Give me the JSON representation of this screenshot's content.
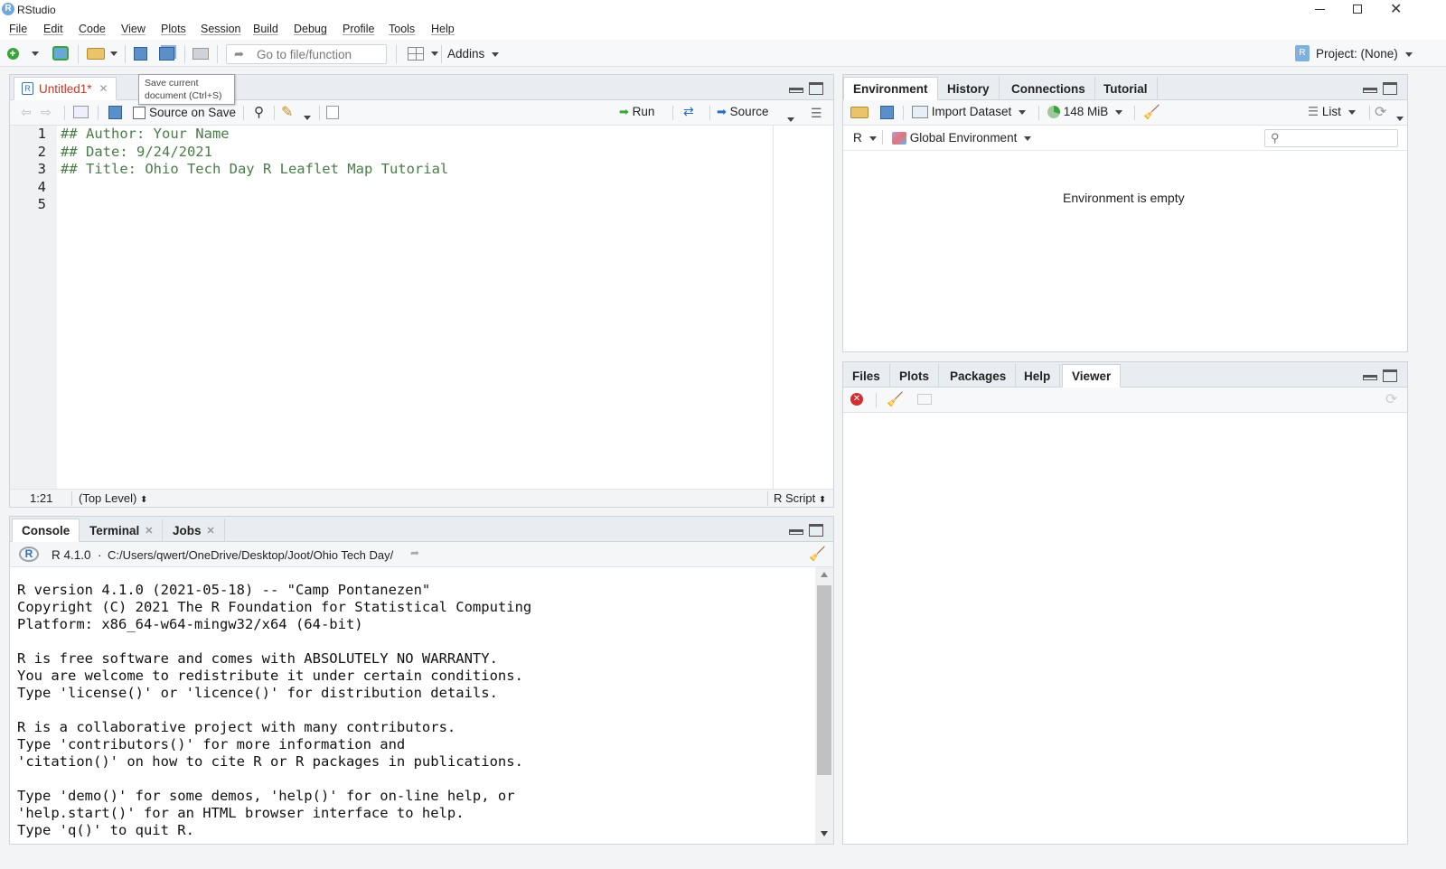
{
  "window": {
    "title": "RStudio"
  },
  "menu": [
    "File",
    "Edit",
    "Code",
    "View",
    "Plots",
    "Session",
    "Build",
    "Debug",
    "Profile",
    "Tools",
    "Help"
  ],
  "toolbar": {
    "goto_placeholder": "Go to file/function",
    "addins_label": "Addins",
    "project_label": "Project: (None)"
  },
  "tooltip": {
    "line1": "Save current",
    "line2": "document (Ctrl+S)"
  },
  "editor": {
    "tab_label": "Untitled1*",
    "source_on_save": "Source on Save",
    "run_label": "Run",
    "source_label": "Source",
    "line_numbers": [
      "1",
      "2",
      "3",
      "4",
      "5"
    ],
    "lines": [
      "## Author: Your Name",
      "## Date: 9/24/2021",
      "## Title: Ohio Tech Day R Leaflet Map Tutorial",
      "",
      ""
    ],
    "status_position": "1:21",
    "status_scope": "(Top Level)",
    "status_filetype": "R Script"
  },
  "console": {
    "tabs": [
      "Console",
      "Terminal",
      "Jobs"
    ],
    "r_version": "R 4.1.0",
    "path": "C:/Users/qwert/OneDrive/Desktop/Joot/Ohio Tech Day/",
    "lines": [
      "R version 4.1.0 (2021-05-18) -- \"Camp Pontanezen\"",
      "Copyright (C) 2021 The R Foundation for Statistical Computing",
      "Platform: x86_64-w64-mingw32/x64 (64-bit)",
      "",
      "R is free software and comes with ABSOLUTELY NO WARRANTY.",
      "You are welcome to redistribute it under certain conditions.",
      "Type 'license()' or 'licence()' for distribution details.",
      "",
      "R is a collaborative project with many contributors.",
      "Type 'contributors()' for more information and",
      "'citation()' on how to cite R or R packages in publications.",
      "",
      "Type 'demo()' for some demos, 'help()' for on-line help, or",
      "'help.start()' for an HTML browser interface to help.",
      "Type 'q()' to quit R."
    ]
  },
  "environment": {
    "tabs": [
      "Environment",
      "History",
      "Connections",
      "Tutorial"
    ],
    "import_dataset": "Import Dataset",
    "memory": "148 MiB",
    "view_mode": "List",
    "language": "R",
    "scope": "Global Environment",
    "empty_message": "Environment is empty"
  },
  "files": {
    "tabs": [
      "Files",
      "Plots",
      "Packages",
      "Help",
      "Viewer"
    ]
  },
  "colors": {
    "accent": "#4a7c4a",
    "tab_modified": "#c0392b",
    "r_blue": "#2a6ebb"
  }
}
